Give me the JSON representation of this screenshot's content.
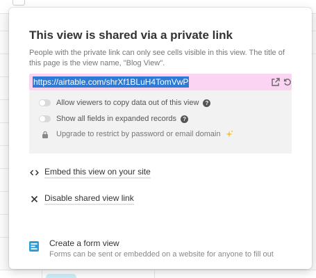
{
  "popover": {
    "title": "This view is shared via a private link",
    "description": "People with the private link can only see cells visible in this view. The title of this page is the view name, \"Blog View\".",
    "share_url": "https://airtable.com/shrXf1BLuH4TomVwP",
    "options": {
      "allow_copy_label": "Allow viewers to copy data out of this view",
      "show_all_fields_label": "Show all fields in expanded records",
      "upgrade_label": "Upgrade to restrict by password or email domain"
    },
    "embed_label": "Embed this view on your site",
    "disable_label": "Disable shared view link",
    "form": {
      "title": "Create a form view",
      "subtitle": "Forms can be sent or embedded on a website for anyone to fill out"
    }
  },
  "colors": {
    "link_background": "#fbd4f3",
    "url_highlight": "#2f7bd4",
    "form_icon": "#2d9fd8",
    "sparkle": "#f4c430"
  },
  "icons": {
    "open": "external-link-icon",
    "regenerate": "refresh-icon",
    "help": "question-circle-icon",
    "lock": "lock-icon",
    "sparkle": "sparkle-icon",
    "embed": "code-icon",
    "disable": "x-icon",
    "form": "form-view-icon"
  }
}
